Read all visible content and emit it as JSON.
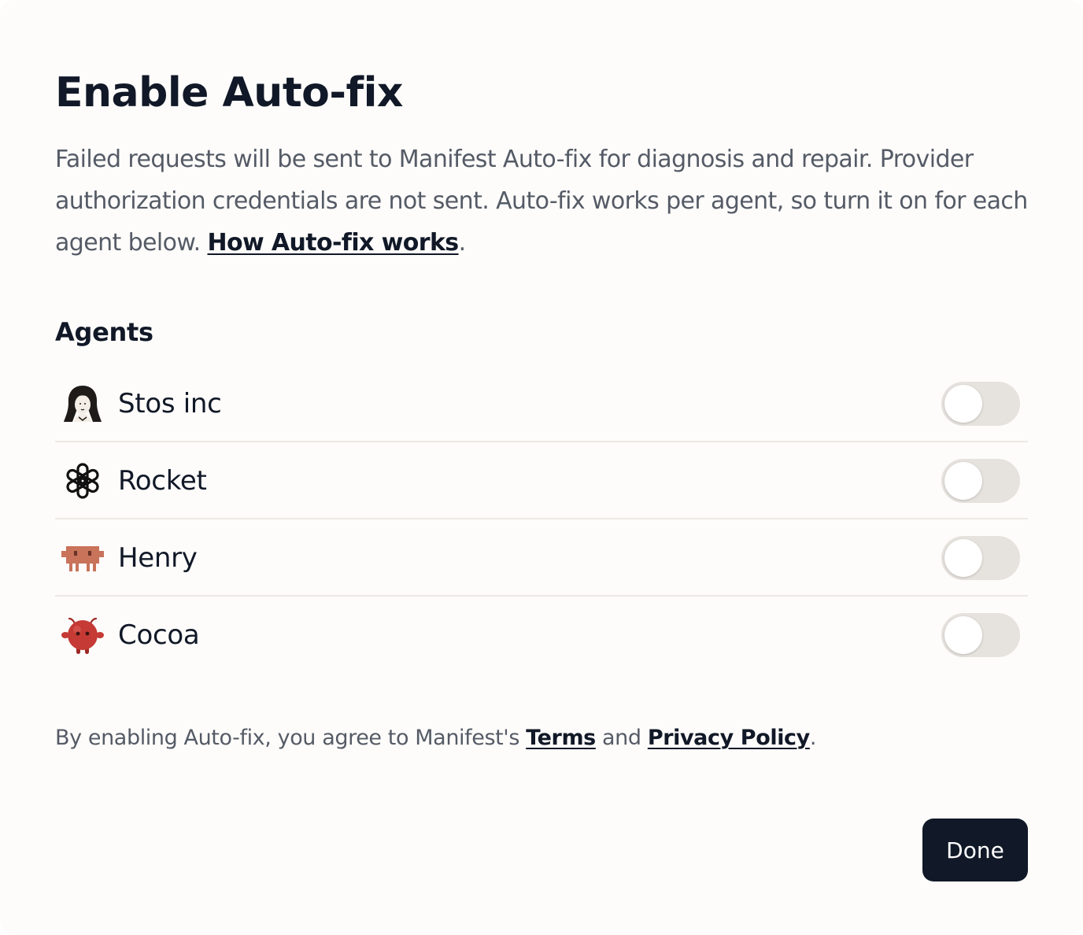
{
  "dialog": {
    "title": "Enable Auto-fix",
    "description": "Failed requests will be sent to Manifest Auto-fix for diagnosis and repair. Provider authorization credentials are not sent. Auto-fix works per agent, so turn it on for each agent below. ",
    "description_link": "How Auto-fix works",
    "description_end": "."
  },
  "agents": {
    "label": "Agents",
    "items": [
      {
        "name": "Stos inc",
        "icon": "woman-portrait-avatar",
        "enabled": false
      },
      {
        "name": "Rocket",
        "icon": "openai-logo",
        "enabled": false
      },
      {
        "name": "Henry",
        "icon": "pixel-robot-avatar",
        "enabled": false
      },
      {
        "name": "Cocoa",
        "icon": "red-bug-avatar",
        "enabled": false
      }
    ]
  },
  "legal": {
    "prefix": "By enabling Auto-fix, you agree to Manifest's ",
    "terms": "Terms",
    "and": " and ",
    "privacy": "Privacy Policy",
    "suffix": "."
  },
  "footer": {
    "done_label": "Done"
  },
  "colors": {
    "background": "#fdfcfa",
    "text_primary": "#111827",
    "text_secondary": "#555b66",
    "toggle_off": "#e6e2dd",
    "button": "#111827",
    "henry_avatar": "#c8735a",
    "cocoa_avatar": "#c53a34"
  }
}
